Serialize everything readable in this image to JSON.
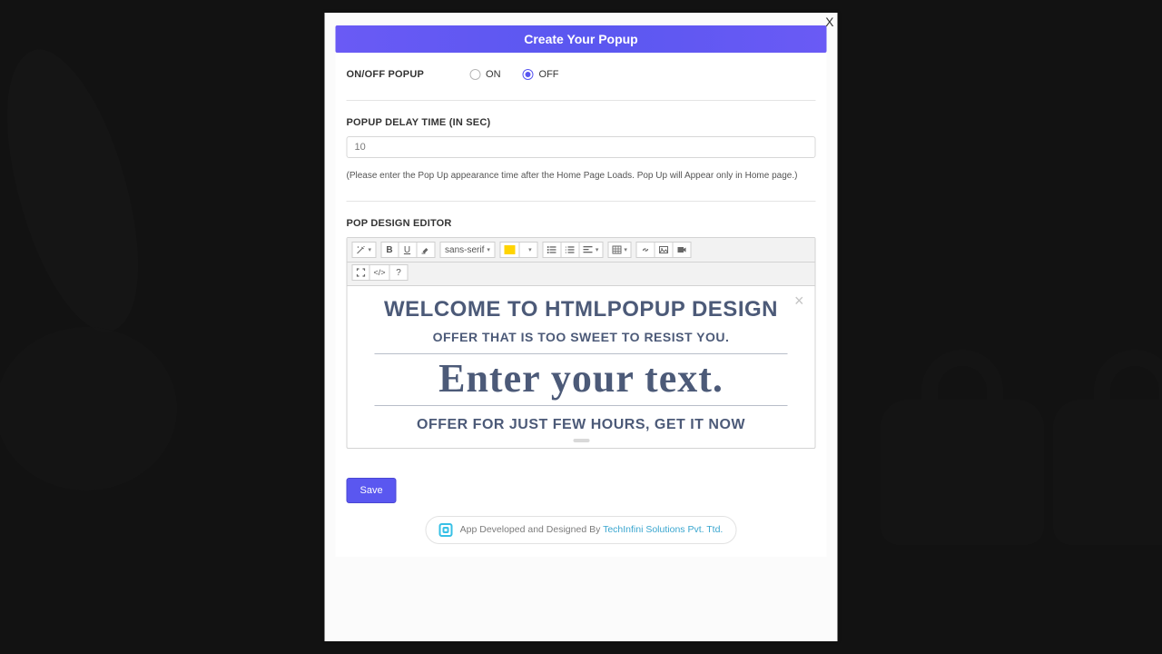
{
  "modal": {
    "title": "Create Your Popup",
    "close_symbol": "X"
  },
  "onoff": {
    "label": "ON/OFF POPUP",
    "options": {
      "on": "ON",
      "off": "OFF"
    },
    "selected": "off"
  },
  "delay": {
    "label": "POPUP DELAY TIME (IN SEC)",
    "value": "10",
    "hint": "(Please enter the Pop Up appearance time after the Home Page Loads. Pop Up will Appear only in Home page.)"
  },
  "editor": {
    "label": "POP DESIGN EDITOR",
    "font_family": "sans-serif",
    "canvas": {
      "heading": "WELCOME TO HTMLPOPUP DESIGN",
      "offer_top": "OFFER THAT IS TOO SWEET TO RESIST YOU.",
      "big_text": "Enter your text.",
      "offer_bottom": "OFFER FOR JUST FEW HOURS, GET IT NOW"
    }
  },
  "save_label": "Save",
  "credit": {
    "prefix": "App Developed and Designed By ",
    "company": "TechInfini Solutions Pvt. Ttd."
  }
}
